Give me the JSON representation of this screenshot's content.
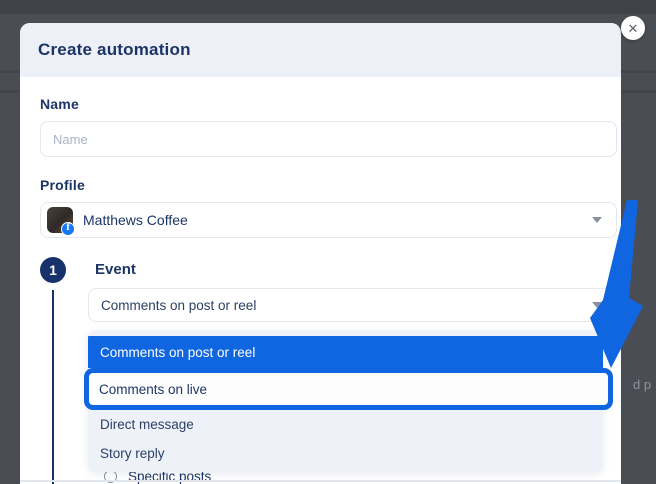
{
  "window": {
    "background_fragment": "d p"
  },
  "modal": {
    "title": "Create automation",
    "close_label": "✕",
    "name": {
      "label": "Name",
      "placeholder": "Name",
      "value": ""
    },
    "profile": {
      "label": "Profile",
      "selected": "Matthews Coffee",
      "facebook_badge": "f"
    },
    "step1": {
      "number": "1",
      "label": "Event"
    },
    "event": {
      "selected_value": "Comments on post or reel",
      "options": [
        {
          "label": "Comments on post or reel",
          "state": "selected"
        },
        {
          "label": "Comments on live",
          "state": "highlighted"
        },
        {
          "label": "Direct message",
          "state": "normal"
        },
        {
          "label": "Story reply",
          "state": "normal"
        }
      ]
    },
    "behind_dropdown": {
      "specific_posts_label": "Specific posts"
    }
  },
  "colors": {
    "accent_blue": "#0f66e0",
    "navy": "#16316b",
    "facebook_blue": "#1877f2",
    "overlay_gray": "#4a4e54",
    "header_bg": "#eef0f7",
    "menu_bg": "#eef2f8"
  }
}
